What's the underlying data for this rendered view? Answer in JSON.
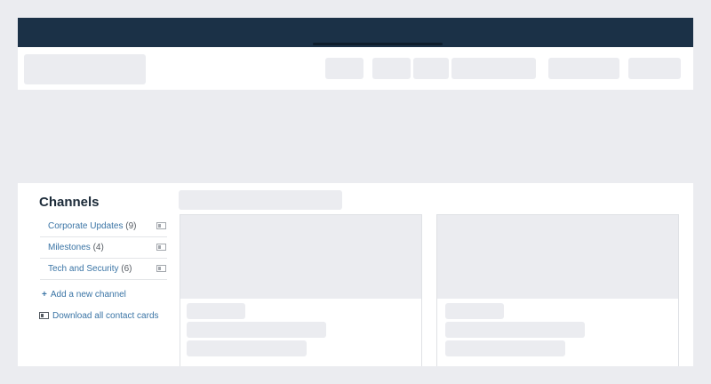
{
  "sidebar": {
    "title": "Channels",
    "channels": [
      {
        "label": "Corporate Updates",
        "count": "(9)"
      },
      {
        "label": "Milestones",
        "count": "(4)"
      },
      {
        "label": "Tech and Security",
        "count": "(6)"
      }
    ],
    "add_channel": "Add a new channel",
    "download_cards": "Download all contact cards"
  },
  "icons": {
    "plus": "plus-icon",
    "contact_card": "contact-card-icon"
  },
  "colors": {
    "topbar": "#1b3147",
    "link": "#3a74a5",
    "placeholder": "#ebecf0",
    "background": "#ebecf0"
  }
}
